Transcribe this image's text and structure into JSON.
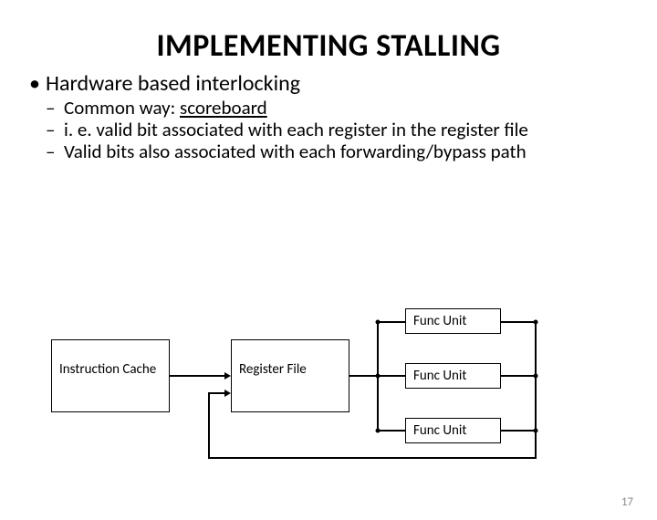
{
  "title": "IMPLEMENTING STALLING",
  "bullets": {
    "l1": "Hardware based interlocking",
    "l2a_prefix": "Common way: ",
    "l2a_emph": "scoreboard",
    "l2b": "i. e. valid bit associated with each register in the register file",
    "l2c": "Valid bits also associated with each forwarding/bypass path"
  },
  "diagram": {
    "instruction_cache": "Instruction Cache",
    "register_file": "Register File",
    "func_unit": "Func Unit"
  },
  "page_number": "17"
}
